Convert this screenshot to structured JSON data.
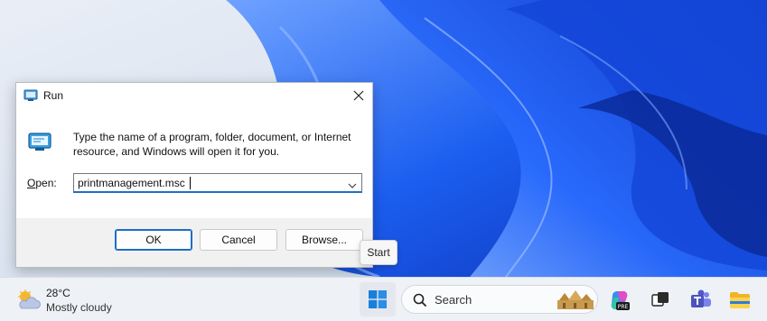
{
  "run_dialog": {
    "title": "Run",
    "description": "Type the name of a program, folder, document, or Internet resource, and Windows will open it for you.",
    "open_label_accel": "O",
    "open_label_rest": "pen:",
    "open_value": "printmanagement.msc",
    "buttons": {
      "ok": "OK",
      "cancel": "Cancel",
      "browse": "Browse..."
    }
  },
  "tooltip": {
    "text": "Start"
  },
  "taskbar": {
    "weather": {
      "temperature": "28°C",
      "condition": "Mostly cloudy",
      "icon": "partly-cloudy-icon"
    },
    "search": {
      "label": "Search"
    },
    "icons": [
      "windows-start-icon",
      "search-icon",
      "copilot-icon",
      "task-view-icon",
      "teams-icon",
      "file-explorer-icon"
    ]
  },
  "colors": {
    "accent": "#1d6fc2",
    "wallpaper_blue": "#1f5fe0",
    "dialog_footer": "#f1f1f1",
    "taskbar_bg": "#eef1f5"
  }
}
